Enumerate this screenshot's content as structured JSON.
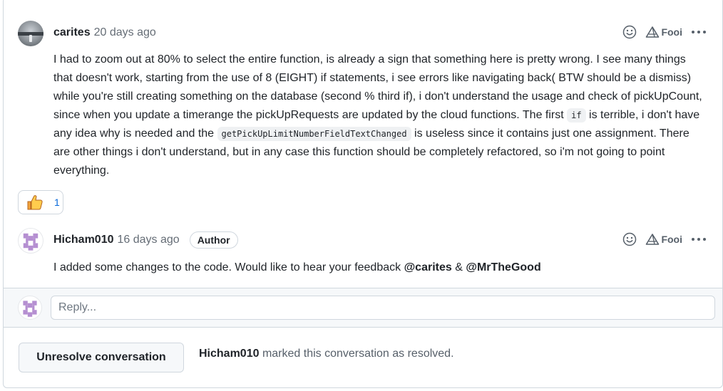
{
  "comments": [
    {
      "author": "carites",
      "time": "20 days ago",
      "body": {
        "p1": "I had to zoom out at 80% to select the entire function, is already a sign that something here is pretty wrong. I see many things that doesn't work, starting from the use of 8 (EIGHT) if statements, i see errors like navigating back( BTW should be a dismiss) while you're still creating something on the database (second % third if), i don't understand the usage and check of pickUpCount, since when you update a timerange the pickUpRequests are updated by the cloud functions. The first ",
        "code1": "if",
        "p2": " is terrible, i don't have any idea why is needed and the ",
        "code2": "getPickUpLimitNumberFieldTextChanged",
        "p3": " is useless since it contains just one assignment. There are other things i don't understand, but in any case this function should be completely refactored, so i'm not going to point everything."
      },
      "reaction": {
        "icon": "thumbs-up-icon",
        "count": "1"
      },
      "action_label": "Fooi"
    },
    {
      "author": "Hicham010",
      "time": "16 days ago",
      "badge": "Author",
      "body": {
        "text": "I added some changes to the code. Would like to hear your feedback ",
        "mention1": "@carites",
        "amp": " & ",
        "mention2": "@MrTheGood"
      },
      "action_label": "Fooi"
    }
  ],
  "reply": {
    "placeholder": "Reply..."
  },
  "resolve": {
    "button_label": "Unresolve conversation",
    "note_user": "Hicham010",
    "note_text": " marked this conversation as resolved."
  },
  "colors": {
    "accent": "#0969da",
    "border": "#d0d7de",
    "muted": "#656d76",
    "identicon": "#b58fd1"
  }
}
